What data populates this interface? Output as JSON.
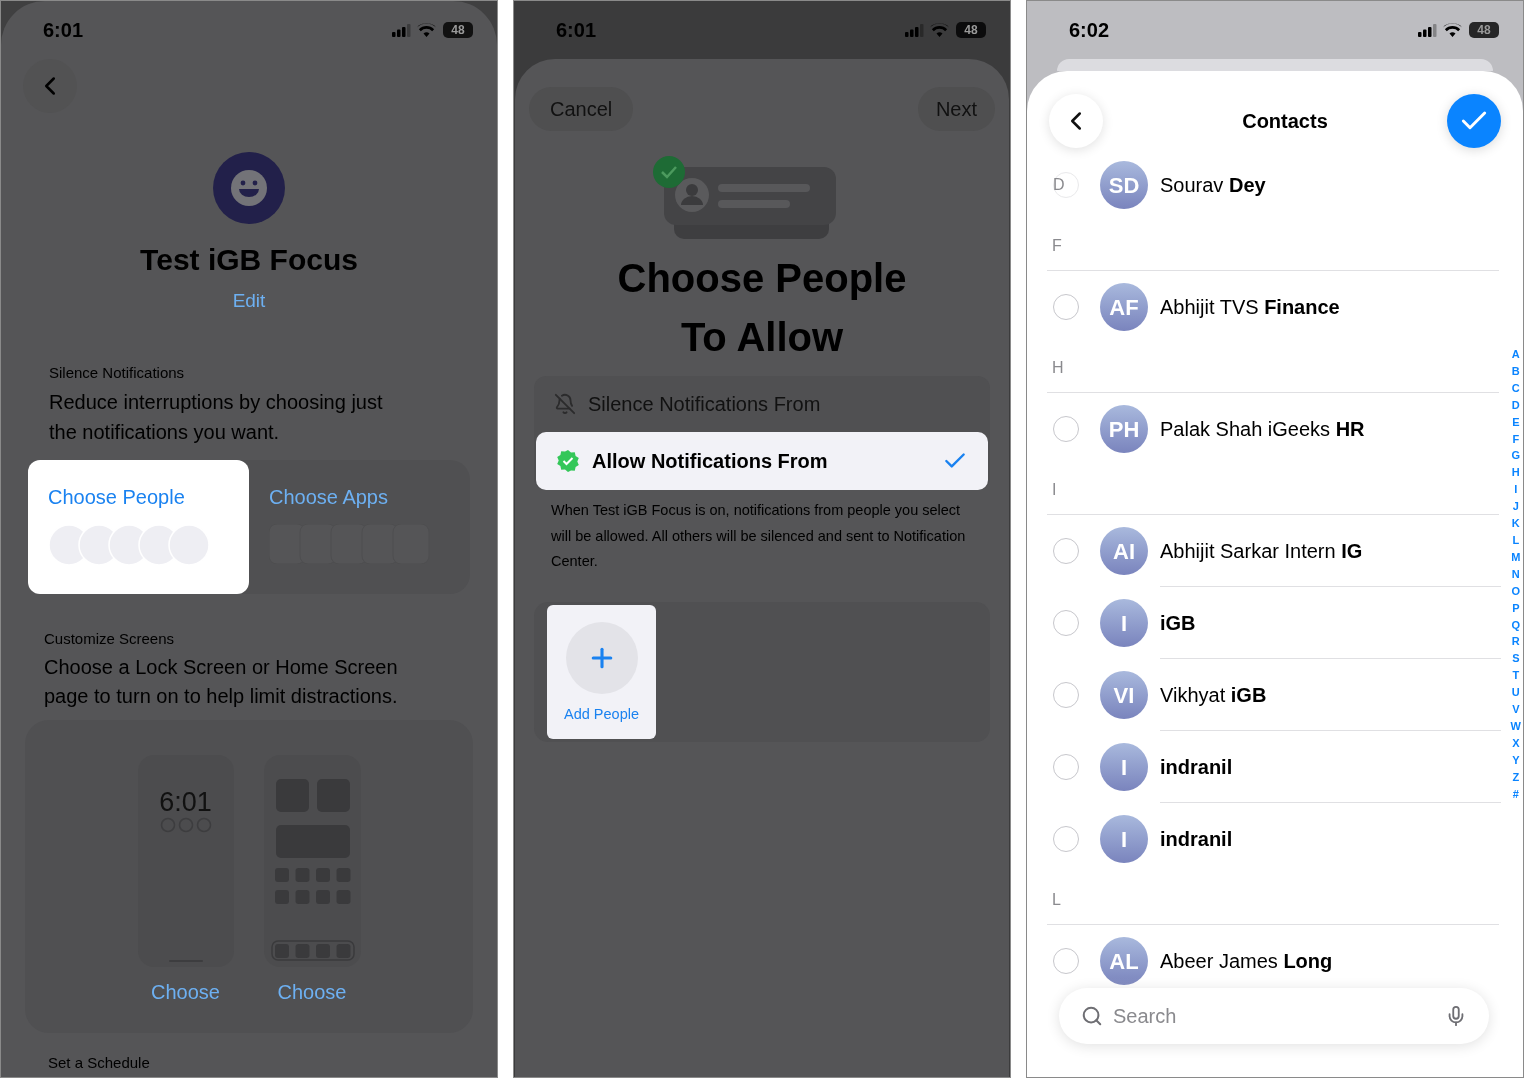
{
  "focus_screen": {
    "status_bar": {
      "time": "6:01",
      "battery": "48"
    },
    "title": "Test iGB Focus",
    "edit_link": "Edit",
    "sections": [
      {
        "kind": "options",
        "heading": "Silence Notifications",
        "description": "Reduce interruptions by choosing just the notifications you want.",
        "options": [
          {
            "kind": "people",
            "label": "Choose People",
            "selected": true
          },
          {
            "kind": "apps",
            "label": "Choose Apps",
            "selected": false
          }
        ]
      },
      {
        "kind": "screens",
        "heading": "Customize Screens",
        "description": "Choose a Lock Screen or Home Screen page to turn on to help limit distractions.",
        "choices": [
          {
            "kind": "lock",
            "time": "6:01",
            "label": "Choose"
          },
          {
            "kind": "home",
            "label": "Choose"
          }
        ]
      },
      {
        "kind": "heading",
        "heading": "Set a Schedule"
      }
    ]
  },
  "people_screen": {
    "status_bar": {
      "time": "6:01",
      "battery": "48"
    },
    "cancel": "Cancel",
    "next": "Next",
    "title_lines": [
      "Choose People",
      "To Allow"
    ],
    "modes": [
      {
        "kind": "silence",
        "label": "Silence Notifications From",
        "selected": false
      },
      {
        "kind": "allow",
        "label": "Allow Notifications From",
        "selected": true
      }
    ],
    "footnote": "When Test iGB Focus is on, notifications from people you select will be allowed. All others will be silenced and sent to Notification Center.",
    "add_button": "Add People"
  },
  "contacts_screen": {
    "status_bar": {
      "time": "6:02",
      "battery": "48"
    },
    "title": "Contacts",
    "rows": [
      {
        "kind": "contact",
        "letter": "D",
        "initials": "SD",
        "name": "Sourav **Dey**",
        "bold": false,
        "selected": false
      },
      {
        "kind": "section",
        "letter": "F"
      },
      {
        "kind": "contact",
        "initials": "AF",
        "name": "Abhijit TVS **Finance**",
        "bold": false,
        "selected": false
      },
      {
        "kind": "section",
        "letter": "H"
      },
      {
        "kind": "contact",
        "initials": "PH",
        "name": "Palak Shah iGeeks **HR**",
        "bold": false,
        "selected": false
      },
      {
        "kind": "section",
        "letter": "I"
      },
      {
        "kind": "contact",
        "initials": "AI",
        "name": "Abhijit Sarkar Intern **IG**",
        "bold": false,
        "selected": false
      },
      {
        "kind": "contact",
        "initials": "I",
        "name": "iGB",
        "bold": true,
        "selected": false
      },
      {
        "kind": "contact",
        "initials": "VI",
        "name": "Vikhyat **iGB**",
        "bold": false,
        "selected": false
      },
      {
        "kind": "contact",
        "initials": "I",
        "name": "indranil",
        "bold": true,
        "selected": false
      },
      {
        "kind": "contact",
        "initials": "I",
        "name": "indranil",
        "bold": true,
        "selected": false
      },
      {
        "kind": "section",
        "letter": "L"
      },
      {
        "kind": "contact",
        "initials": "AL",
        "name": "Abeer James **Long**",
        "bold": false,
        "selected": false
      }
    ],
    "index": [
      "A",
      "B",
      "C",
      "D",
      "E",
      "F",
      "G",
      "H",
      "I",
      "J",
      "K",
      "L",
      "M",
      "N",
      "O",
      "P",
      "Q",
      "R",
      "S",
      "T",
      "U",
      "V",
      "W",
      "X",
      "Y",
      "Z",
      "#"
    ],
    "search": {
      "placeholder": "Search"
    }
  }
}
